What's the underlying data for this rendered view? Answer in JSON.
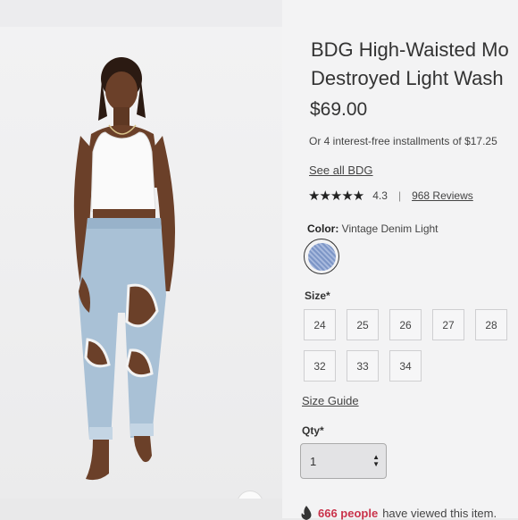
{
  "product": {
    "title_line1": "BDG High-Waisted Mo",
    "title_line2": "Destroyed Light Wash",
    "price": "$69.00",
    "installments": "Or 4 interest-free installments of $17.25",
    "brand_link": "See all BDG",
    "rating": "4.3",
    "rating_separator": "|",
    "reviews": "968 Reviews",
    "stars_icon": "★★★★★",
    "color_label": "Color:",
    "color_value": "Vintage Denim Light",
    "swatch_color": "#8aa2d2"
  },
  "size": {
    "label": "Size*",
    "options": [
      "24",
      "25",
      "26",
      "27",
      "28",
      "32",
      "33",
      "34"
    ]
  },
  "size_guide": "Size Guide",
  "qty": {
    "label": "Qty*",
    "value": "1",
    "arrows": "▲▼"
  },
  "social_proof": {
    "count": "666 people",
    "text": "have viewed this item."
  },
  "icons": {
    "expand": "expand-icon",
    "fire": "fire-icon"
  }
}
